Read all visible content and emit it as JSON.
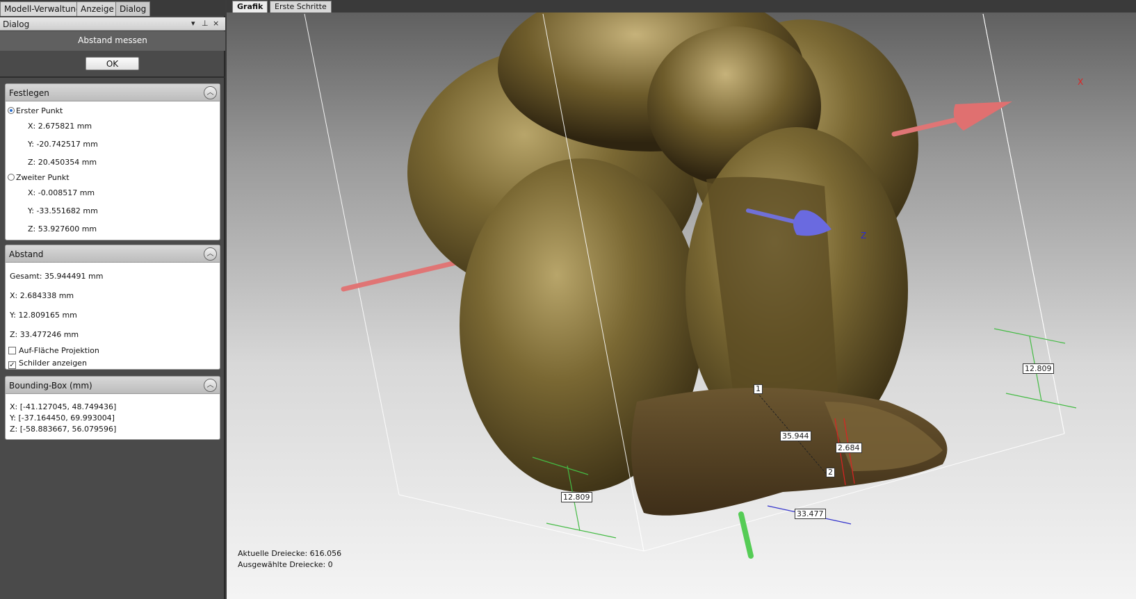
{
  "left_tabs": [
    "Modell-Verwaltung",
    "Anzeige",
    "Dialog"
  ],
  "dialog_header": {
    "title": "Dialog",
    "pin_glyph": "⊥",
    "close_glyph": "×",
    "menu_glyph": "▾"
  },
  "dialog_title": "Abstand messen",
  "ok_label": "OK",
  "festlegen": {
    "title": "Festlegen",
    "first_point_label": "Erster Punkt",
    "first": {
      "x": "X: 2.675821 mm",
      "y": "Y: -20.742517 mm",
      "z": "Z: 20.450354 mm"
    },
    "second_point_label": "Zweiter Punkt",
    "second": {
      "x": "X: -0.008517 mm",
      "y": "Y: -33.551682 mm",
      "z": "Z: 53.927600 mm"
    }
  },
  "abstand": {
    "title": "Abstand",
    "gesamt": "Gesamt: 35.944491 mm",
    "x": "X: 2.684338 mm",
    "y": "Y: 12.809165 mm",
    "z": "Z: 33.477246 mm",
    "projection_label": "Auf-Fläche Projektion",
    "projection_checked": false,
    "labels_label": "Schilder anzeigen",
    "labels_checked": true
  },
  "bbox": {
    "title": "Bounding-Box (mm)",
    "x": "X: [-41.127045, 48.749436]",
    "y": "Y: [-37.164450, 69.993004]",
    "z": "Z: [-58.883667, 56.079596]"
  },
  "right_tabs": [
    "Grafik",
    "Erste Schritte"
  ],
  "viewport": {
    "axis_x_label": "X",
    "axis_z_label": "Z",
    "marker_1": "1",
    "marker_2": "2",
    "label_total": "35.944",
    "label_x": "2.684",
    "label_y_right": "12.809",
    "label_y_left": "12.809",
    "label_z": "33.477",
    "status_current": "Aktuelle Dreiecke: 616.056",
    "status_selected": "Ausgewählte Dreiecke: 0"
  },
  "colors": {
    "axis_x": "#e07070",
    "axis_z": "#6a6ae0",
    "axis_y": "#55cc55",
    "bronze": "#6b5a2a"
  }
}
